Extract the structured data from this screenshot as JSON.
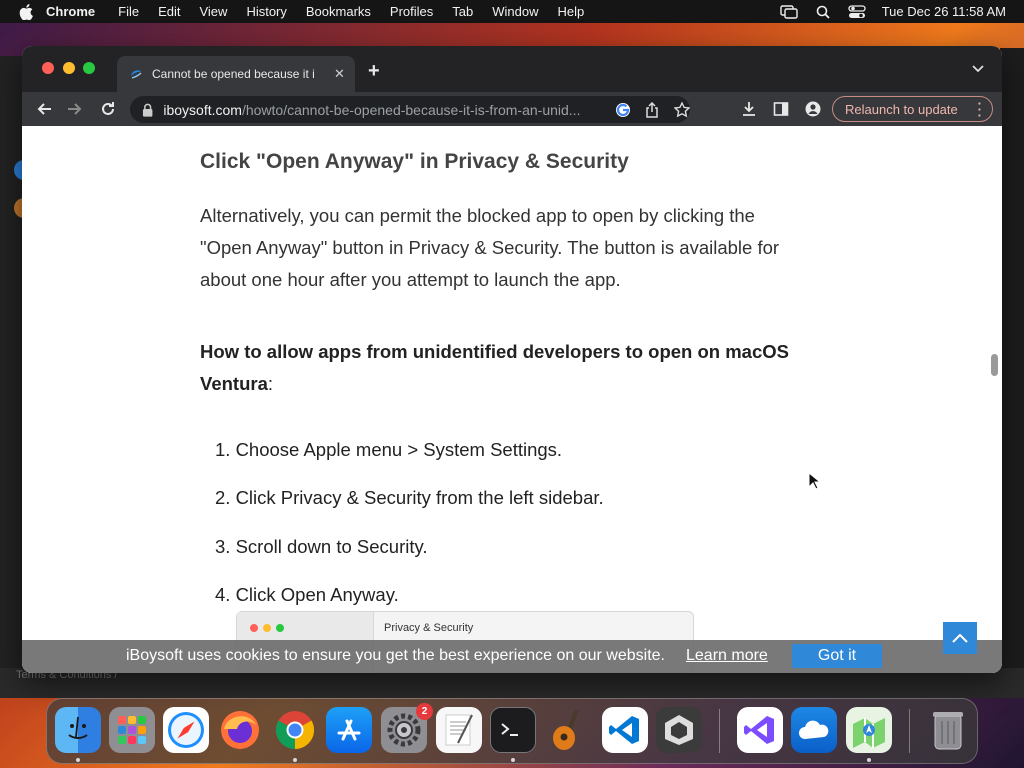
{
  "menubar": {
    "app_name": "Chrome",
    "items": [
      "File",
      "Edit",
      "View",
      "History",
      "Bookmarks",
      "Profiles",
      "Tab",
      "Window",
      "Help"
    ],
    "clock": "Tue Dec 26  11:58 AM"
  },
  "browser": {
    "tab_title": "Cannot be opened because it i",
    "url_host": "iboysoft.com",
    "url_path": "/howto/cannot-be-opened-because-it-is-from-an-unid...",
    "relaunch_label": "Relaunch to update"
  },
  "article": {
    "heading": "Click \"Open Anyway\" in Privacy & Security",
    "paragraph": "Alternatively, you can permit the blocked app to open by clicking the \"Open Anyway\" button in Privacy & Security. The button is available for about one hour after you attempt to launch the app.",
    "howto_bold": "How to allow apps from unidentified developers to open on macOS Ventura",
    "howto_suffix": ":",
    "steps": [
      "1. Choose Apple menu > System Settings.",
      "2. Click Privacy & Security from the left sidebar.",
      "3. Scroll down to Security.",
      "4. Click Open Anyway."
    ],
    "screenshot_title": "Privacy & Security"
  },
  "cookie_banner": {
    "text": "iBoysoft uses cookies to ensure you get the best experience on our website.",
    "link": "Learn more",
    "button": "Got it"
  },
  "background": {
    "terms_text": "Terms & Conditions /"
  },
  "dock": {
    "apps": [
      "Finder",
      "Launchpad",
      "Safari",
      "Firefox",
      "Google Chrome",
      "App Store",
      "System Settings",
      "TextEdit",
      "Terminal",
      "GarageBand",
      "Visual Studio Code",
      "Unity Hub",
      "Visual Studio",
      "iCloud",
      "Maps",
      "Trash"
    ],
    "settings_badge": "2"
  },
  "colors": {
    "accent": "#2f88d8",
    "menubar": "#151515",
    "tab_bg": "#37383b",
    "relaunch": "#f0b7ae"
  }
}
